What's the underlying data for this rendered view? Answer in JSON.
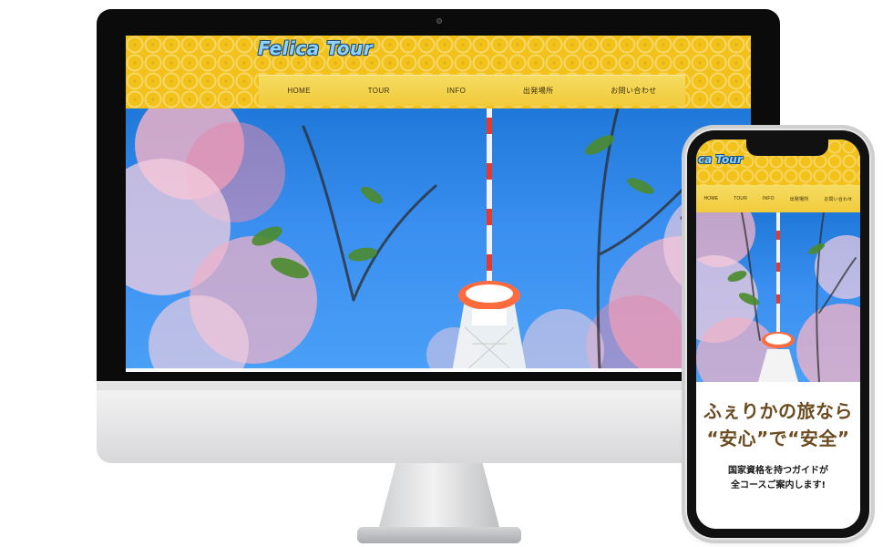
{
  "desktop": {
    "site": {
      "logo_text": "Felica Tour",
      "nav": [
        "HOME",
        "TOUR",
        "INFO",
        "出発場所",
        "お問い合わせ"
      ]
    },
    "hero": {
      "subject": "桜と塔"
    }
  },
  "mobile": {
    "site": {
      "logo_text": "ca Tour",
      "nav": [
        "HOME",
        "TOUR",
        "INFO",
        "出発場所",
        "お問い合わせ"
      ]
    },
    "content": {
      "headline_line1": "ふぇりかの旅なら",
      "headline_line2": "“安心”で“安全”",
      "body_line1": "国家資格を持つガイドが",
      "body_line2": "全コースご案内します!"
    }
  },
  "colors": {
    "primary_yellow": "#f2c21a",
    "sky_blue": "#2f86e8",
    "blossom_pink": "#f6b3c6",
    "text_brown": "#6b4b1f"
  },
  "icons": {
    "camera": "camera-icon",
    "notch": "phone-notch-icon"
  }
}
